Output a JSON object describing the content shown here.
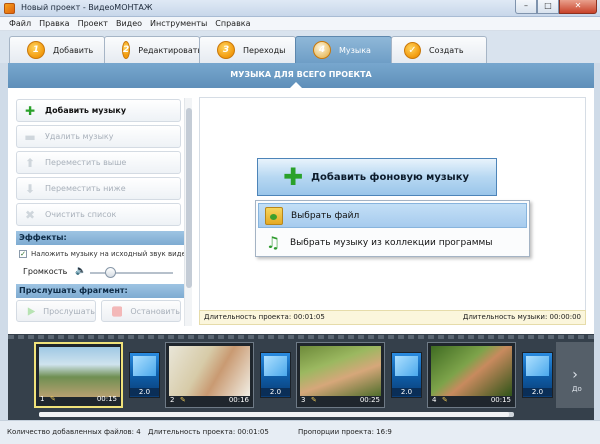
{
  "window": {
    "title": "Новый проект - ВидеоМОНТАЖ"
  },
  "menu": [
    "Файл",
    "Правка",
    "Проект",
    "Видео",
    "Инструменты",
    "Справка"
  ],
  "tabs": [
    {
      "num": "1",
      "label": "Добавить"
    },
    {
      "num": "2",
      "label": "Редактировать"
    },
    {
      "num": "3",
      "label": "Переходы"
    },
    {
      "num": "4",
      "label": "Музыка"
    },
    {
      "label": "Создать"
    }
  ],
  "section_header": "МУЗЫКА ДЛЯ ВСЕГО ПРОЕКТА",
  "left": {
    "add_music": "Добавить музыку",
    "delete_music": "Удалить музыку",
    "move_up": "Переместить выше",
    "move_down": "Переместить ниже",
    "clear_list": "Очистить список",
    "effects_header": "Эффекты:",
    "overlay_checkbox": "Наложить музыку на исходный звук видео",
    "volume_label": "Громкость",
    "preview_header": "Прослушать фрагмент:",
    "listen": "Прослушать",
    "stop": "Остановить"
  },
  "right": {
    "add_bg_music": "Добавить фоновую музыку",
    "menu_choose_file": "Выбрать файл",
    "menu_choose_collection": "Выбрать музыку из коллекции программы",
    "project_duration_label": "Длительность проекта: 00:01:05",
    "music_duration_label": "Длительность музыки: 00:00:00"
  },
  "timeline": {
    "clips": [
      {
        "index": "1",
        "duration": "00:15"
      },
      {
        "index": "2",
        "duration": "00:16"
      },
      {
        "index": "3",
        "duration": "00:25"
      },
      {
        "index": "4",
        "duration": "00:15"
      }
    ],
    "transitions": [
      "2.0",
      "2.0",
      "2.0",
      "2.0"
    ],
    "next_label": "До"
  },
  "status": {
    "files": "Количество добавленных файлов: 4",
    "duration": "Длительность проекта: 00:01:05",
    "ratio": "Пропорции проекта: 16:9"
  },
  "colors": {
    "accent": "#6e9ec6",
    "tab_badge": "#f29a0d",
    "add_green": "#2aa12a",
    "timeline_bg": "#35404b"
  }
}
